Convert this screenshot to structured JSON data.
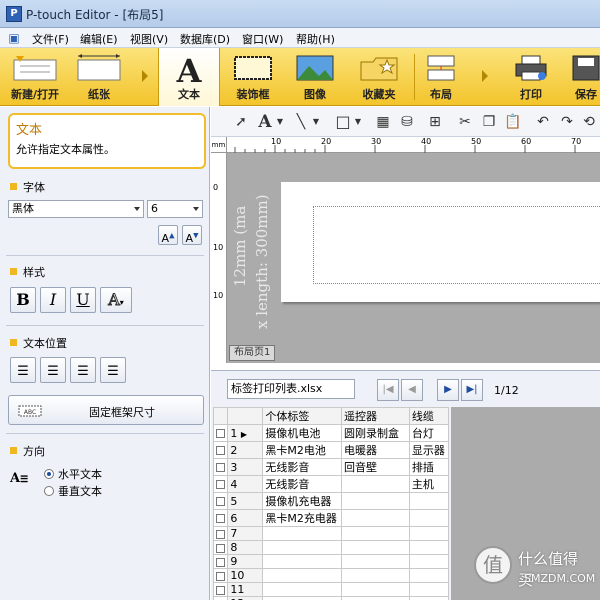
{
  "window": {
    "title": "P-touch Editor - [布局5]"
  },
  "menu": [
    "文件(F)",
    "编辑(E)",
    "视图(V)",
    "数据库(D)",
    "窗口(W)",
    "帮助(H)"
  ],
  "ribbon": {
    "buttons": [
      {
        "label": "新建/打开",
        "icon": "new-open-icon"
      },
      {
        "label": "纸张",
        "icon": "paper-icon"
      },
      {
        "label": "文本",
        "icon": "text-A-icon",
        "active": true
      },
      {
        "label": "装饰框",
        "icon": "frame-icon"
      },
      {
        "label": "图像",
        "icon": "image-icon"
      },
      {
        "label": "收藏夹",
        "icon": "favorites-folder-icon"
      },
      {
        "label": "布局",
        "icon": "layout-icon"
      },
      {
        "label": "打印",
        "icon": "printer-icon"
      },
      {
        "label": "保存",
        "icon": "save-icon"
      }
    ]
  },
  "panel": {
    "info": {
      "title": "文本",
      "desc": "允许指定文本属性。"
    },
    "font": {
      "heading": "字体",
      "name": "黑体",
      "size": "6"
    },
    "style": {
      "heading": "样式"
    },
    "position": {
      "heading": "文本位置",
      "fix_frame": "固定框架尺寸"
    },
    "direction": {
      "heading": "方向",
      "horizontal": "水平文本",
      "vertical": "垂直文本",
      "selected": "horizontal"
    }
  },
  "canvas": {
    "ruler_unit": "mm",
    "ruler_labels": [
      "10",
      "20",
      "30",
      "40",
      "50",
      "60",
      "70"
    ],
    "vruler_labels": [
      "0",
      "10",
      "10"
    ],
    "vertical_text_1": "12mm (ma",
    "vertical_text_2": "x length: 300mm)",
    "page_tab": "布局页1"
  },
  "database": {
    "file": "标签打印列表.xlsx",
    "pager": "1/12",
    "columns": [
      "个体标签",
      "遥控器",
      "线缆"
    ],
    "rows": [
      {
        "n": "1",
        "c1": "摄像机电池",
        "c2": "圆刚录制盒",
        "c3": "台灯",
        "current": true
      },
      {
        "n": "2",
        "c1": "黑卡M2电池",
        "c2": "电暖器",
        "c3": "显示器"
      },
      {
        "n": "3",
        "c1": "无线影音",
        "c2": "回音壁",
        "c3": "排插"
      },
      {
        "n": "4",
        "c1": "无线影音",
        "c2": "",
        "c3": "主机"
      },
      {
        "n": "5",
        "c1": "摄像机充电器",
        "c2": "",
        "c3": ""
      },
      {
        "n": "6",
        "c1": "黑卡M2充电器",
        "c2": "",
        "c3": ""
      },
      {
        "n": "7",
        "c1": "",
        "c2": "",
        "c3": ""
      },
      {
        "n": "8",
        "c1": "",
        "c2": "",
        "c3": ""
      },
      {
        "n": "9",
        "c1": "",
        "c2": "",
        "c3": ""
      },
      {
        "n": "10",
        "c1": "",
        "c2": "",
        "c3": ""
      },
      {
        "n": "11",
        "c1": "",
        "c2": "",
        "c3": ""
      },
      {
        "n": "12",
        "c1": "",
        "c2": "",
        "c3": ""
      }
    ]
  },
  "watermark": {
    "text": "什么值得买",
    "site": "SMZDM.COM"
  }
}
